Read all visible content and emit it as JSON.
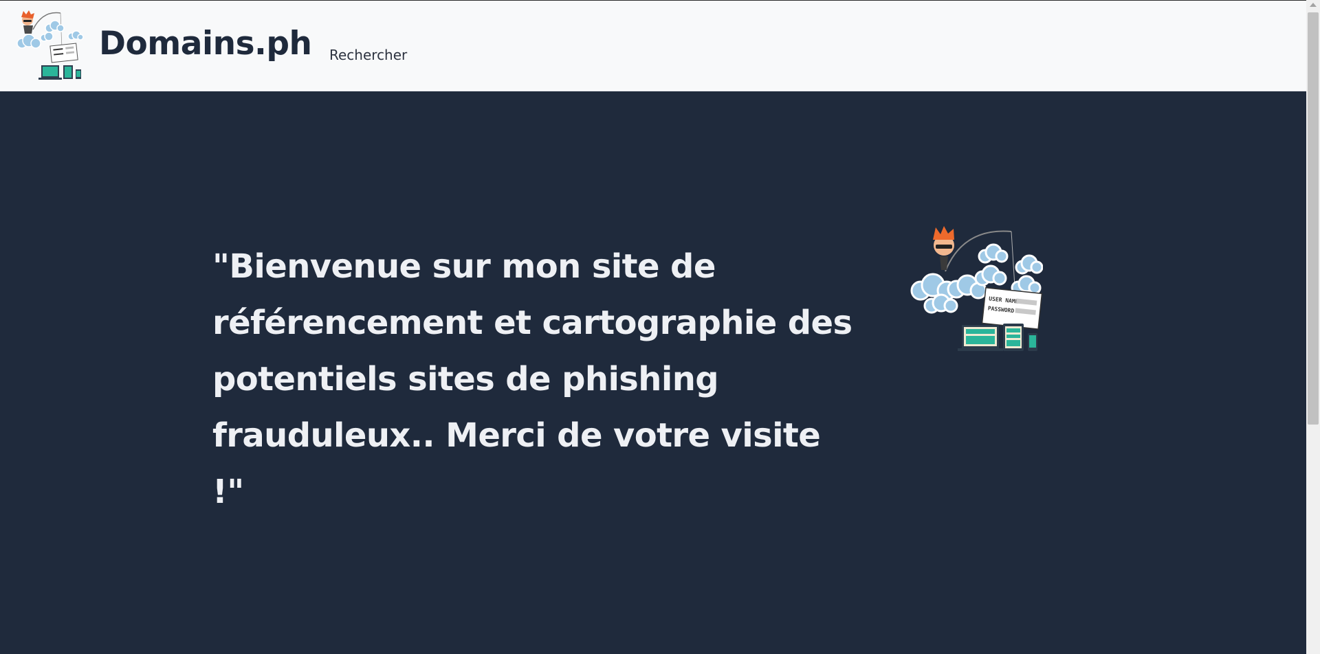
{
  "navbar": {
    "brand_name": "Domains.ph",
    "logo_icon": "phishing-hacker-logo-icon",
    "links": [
      {
        "label": "Rechercher"
      }
    ]
  },
  "hero": {
    "message": "\"Bienvenue sur mon site de référencement et cartographie des potentiels sites de phishing frauduleux.. Merci de votre visite !\"",
    "illustration_icon": "phishing-hacker-illustration",
    "illustration_form": {
      "username_label": "USER NAME",
      "password_label": "PASSWORD"
    }
  },
  "colors": {
    "hero_background": "#1f2a3c",
    "navbar_background": "#f8f9fa",
    "hero_text": "#eef0f4",
    "brand_text": "#1f2a3c"
  }
}
